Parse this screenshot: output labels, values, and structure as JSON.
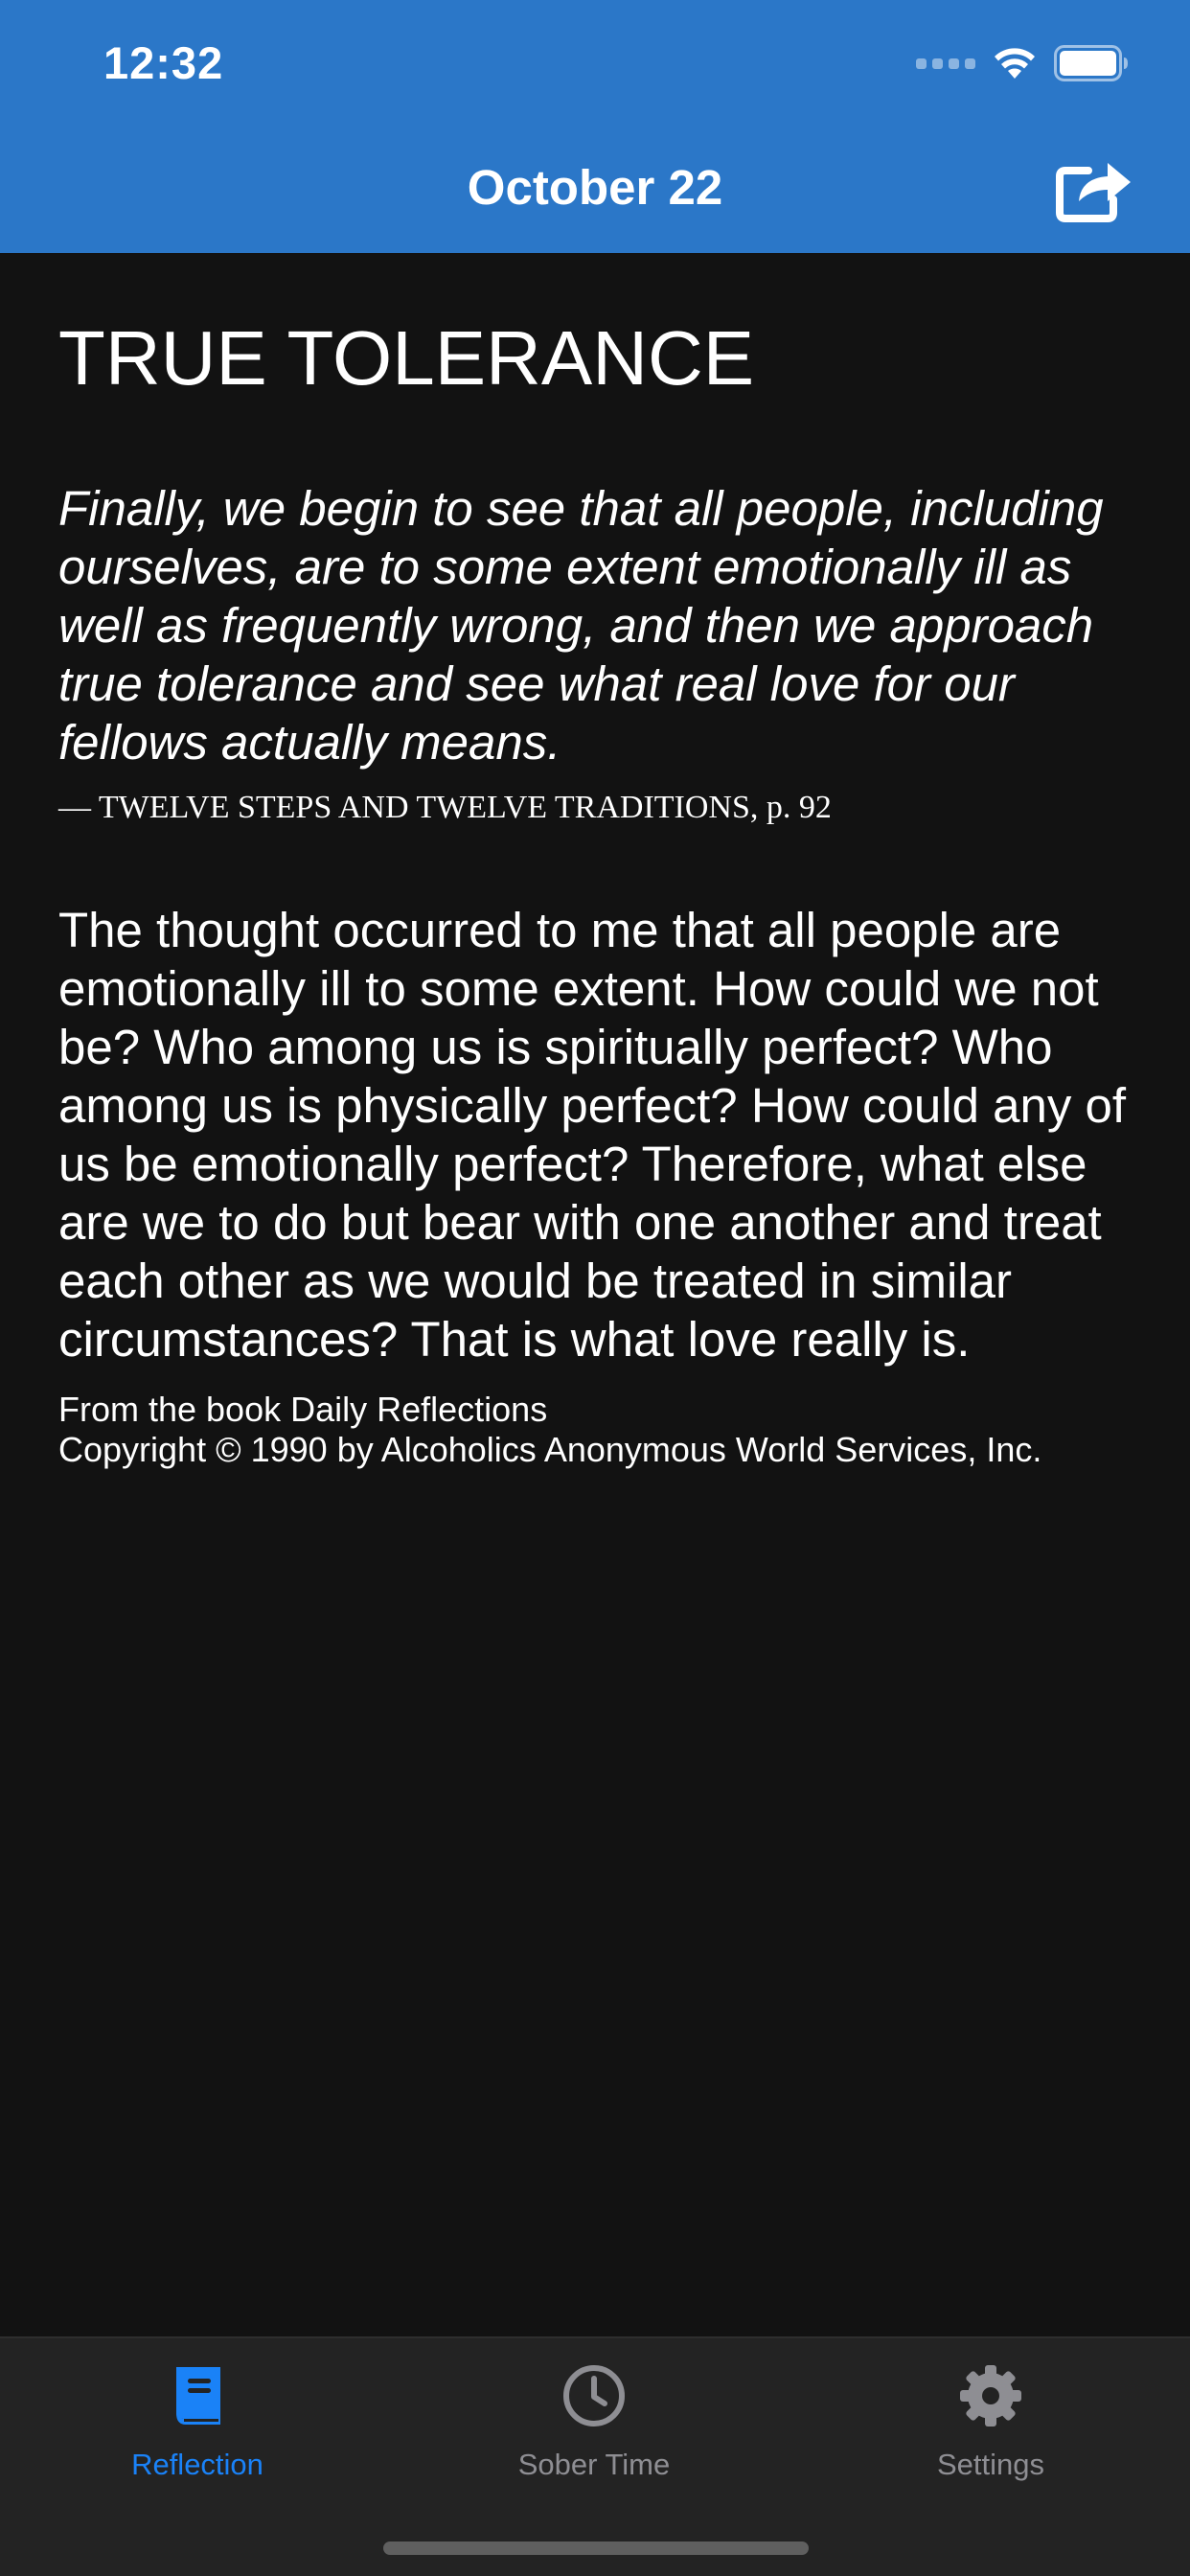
{
  "status_bar": {
    "time": "12:32",
    "icons": [
      "cellular-signal-icon",
      "wifi-icon",
      "battery-icon"
    ]
  },
  "nav": {
    "title": "October 22",
    "share_icon": "share-icon"
  },
  "reflection": {
    "title": "TRUE TOLERANCE",
    "quote": "Finally, we begin to see that all people, including ourselves, are to some extent emotionally ill as well as frequently wrong, and then we approach true tolerance and see what real love for our fellows actually means.",
    "source": "— TWELVE STEPS AND TWELVE TRADITIONS, p. 92",
    "body": "The thought occurred to me that all people are emotionally ill to some extent. How could we not be? Who among us is spiritually perfect? Who among us is physically perfect? How could any of us be emotionally perfect? Therefore, what else are we to do but bear with one another and treat each other as we would be treated in similar circumstances? That is what love really is.",
    "credit_line1": "From the book Daily Reflections",
    "credit_line2": "Copyright © 1990 by Alcoholics Anonymous World Services, Inc."
  },
  "tabbar": {
    "tabs": [
      {
        "label": "Reflection",
        "icon": "book-icon",
        "active": true
      },
      {
        "label": "Sober Time",
        "icon": "clock-icon",
        "active": false
      },
      {
        "label": "Settings",
        "icon": "gear-icon",
        "active": false
      }
    ]
  },
  "colors": {
    "header": "#2b77c8",
    "background": "#121212",
    "tabbar": "#232323",
    "accent": "#1a82f7",
    "inactive": "#8e8e93"
  }
}
